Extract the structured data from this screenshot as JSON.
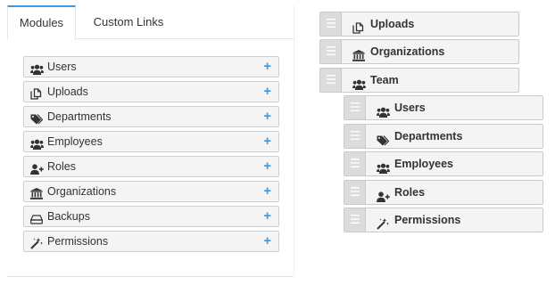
{
  "tabs": [
    {
      "label": "Modules",
      "active": true
    },
    {
      "label": "Custom Links",
      "active": false
    }
  ],
  "modules": [
    {
      "label": "Users",
      "icon": "users-icon"
    },
    {
      "label": "Uploads",
      "icon": "copy-icon"
    },
    {
      "label": "Departments",
      "icon": "tags-icon"
    },
    {
      "label": "Employees",
      "icon": "users-icon"
    },
    {
      "label": "Roles",
      "icon": "user-plus-icon"
    },
    {
      "label": "Organizations",
      "icon": "bank-icon"
    },
    {
      "label": "Backups",
      "icon": "hdd-icon"
    },
    {
      "label": "Permissions",
      "icon": "magic-wand-icon"
    }
  ],
  "add_symbol": "+",
  "tree": [
    {
      "label": "Uploads",
      "icon": "copy-icon",
      "level": 0
    },
    {
      "label": "Organizations",
      "icon": "bank-icon",
      "level": 0
    },
    {
      "label": "Team",
      "icon": "users-icon",
      "level": 0
    },
    {
      "label": "Users",
      "icon": "users-icon",
      "level": 1
    },
    {
      "label": "Departments",
      "icon": "tags-icon",
      "level": 1
    },
    {
      "label": "Employees",
      "icon": "users-icon",
      "level": 1
    },
    {
      "label": "Roles",
      "icon": "user-plus-icon",
      "level": 1
    },
    {
      "label": "Permissions",
      "icon": "magic-wand-icon",
      "level": 1
    }
  ],
  "colors": {
    "accent": "#3f99dc",
    "item_bg": "#f4f4f4",
    "handle_bg": "#dcdcdc"
  }
}
